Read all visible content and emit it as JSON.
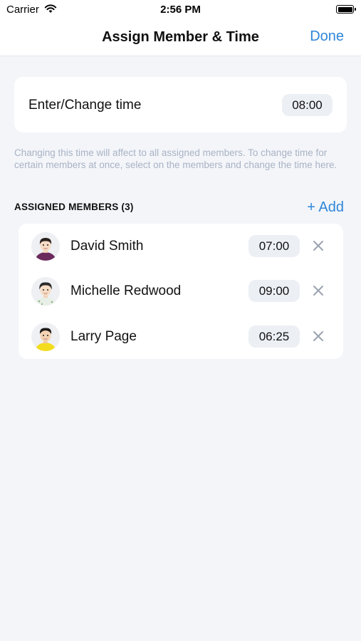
{
  "status_bar": {
    "carrier": "Carrier",
    "time": "2:56 PM"
  },
  "nav": {
    "title": "Assign Member & Time",
    "done_label": "Done"
  },
  "time_card": {
    "label": "Enter/Change time",
    "value": "08:00"
  },
  "hint_text": "Changing this time will affect to all assigned members. To change time for certain members at once, select on the members and change the time here.",
  "members_section": {
    "header": "ASSIGNED MEMBERS (3)",
    "add_label": "+ Add"
  },
  "members": [
    {
      "name": "David Smith",
      "time": "07:00",
      "avatar": "avatar-david-icon",
      "shirt_color": "#6b2a5c"
    },
    {
      "name": "Michelle Redwood",
      "time": "09:00",
      "avatar": "avatar-michelle-icon",
      "shirt_color": "#e8efe6"
    },
    {
      "name": "Larry Page",
      "time": "06:25",
      "avatar": "avatar-larry-icon",
      "shirt_color": "#f2dc1d"
    }
  ],
  "colors": {
    "accent": "#2f86d8",
    "background": "#f3f5f9",
    "hint": "#a9b3c4",
    "pill": "#eceff4"
  }
}
